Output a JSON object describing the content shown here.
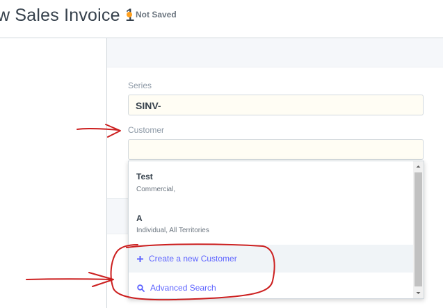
{
  "header": {
    "title": "w Sales Invoice 1",
    "status": "Not Saved",
    "status_color": "#ff9f1c"
  },
  "form": {
    "series": {
      "label": "Series",
      "value": "SINV-"
    },
    "customer": {
      "label": "Customer",
      "value": ""
    }
  },
  "dropdown": {
    "items": [
      {
        "title": "Test",
        "subtitle": "Commercial,"
      },
      {
        "title": "A",
        "subtitle": "Individual, All Territories"
      }
    ],
    "actions": [
      {
        "label": "Create a new Customer",
        "icon": "plus-icon"
      },
      {
        "label": "Advanced Search",
        "icon": "search-icon"
      }
    ]
  },
  "colors": {
    "accent": "#5e64ff",
    "annotation": "#cc1f1f",
    "input_background": "#fffdf4"
  }
}
